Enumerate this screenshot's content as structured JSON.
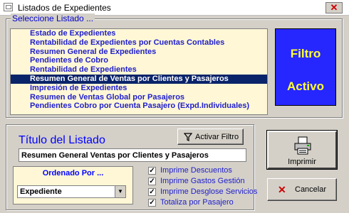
{
  "window": {
    "title": "Listados de Expedientes"
  },
  "listado": {
    "label": "Seleccione Listado ...",
    "items": [
      "Estado de Expedientes",
      "Rentabilidad de Expedientes por Cuentas Contables",
      "Resumen General de Expedientes",
      "Pendientes de Cobro",
      "Rentabilidad de Expedientes",
      "Resumen General de Ventas por Clientes y Pasajeros",
      "Impresión de Expedientes",
      "Resumen de Ventas Global por Pasajeros",
      "Pendientes Cobro por Cuenta Pasajero (Expd.Individuales)"
    ],
    "selected_index": 5
  },
  "filtro": {
    "line1": "Filtro",
    "line2": "Activo",
    "color": "#ffff33",
    "background": "#2626ff"
  },
  "titulo": {
    "label": "Título del Listado",
    "value": "Resumen General Ventas por Clientes y Pasajeros",
    "activar_filtro_label": "Activar Filtro"
  },
  "ordenado": {
    "label": "Ordenado Por ...",
    "value": "Expediente"
  },
  "options": [
    {
      "label": "Imprime Descuentos",
      "checked": true
    },
    {
      "label": "Imprime Gastos Gestión",
      "checked": true
    },
    {
      "label": "Imprime Desglose Servicios",
      "checked": true
    },
    {
      "label": "Totaliza por Pasajero",
      "checked": true
    }
  ],
  "buttons": {
    "imprimir": "Imprimir",
    "cancelar": "Cancelar"
  },
  "icons": {
    "app": "window-icon",
    "close": "close-icon",
    "filter": "funnel-icon",
    "print": "printer-icon",
    "cancel": "x-icon"
  }
}
